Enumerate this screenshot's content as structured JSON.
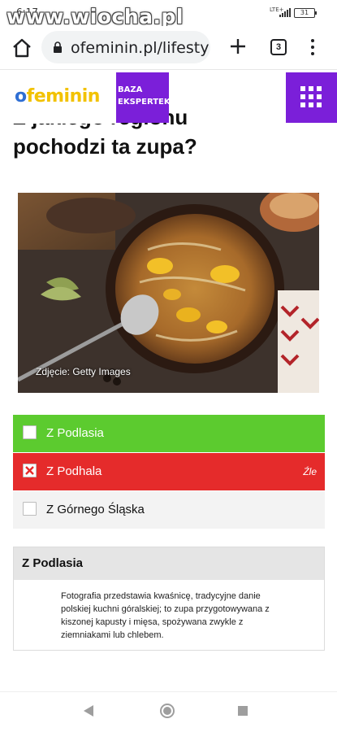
{
  "status_bar": {
    "time": "6:17",
    "watermark": "www.wiocha.pl",
    "network": "LTE+",
    "battery": "31"
  },
  "browser": {
    "url": "ofeminin.pl/lifesty",
    "tab_count": "3"
  },
  "site_header": {
    "logo_text": "ofeminin",
    "baza_line1": "BAZA",
    "baza_line2": "EKSPERTEK"
  },
  "question": {
    "title_line1": "Z jakiego regionu",
    "title_line2": "pochodzi ta zupa?"
  },
  "photo": {
    "credit": "Zdjęcie: Getty Images"
  },
  "answers": [
    {
      "label": "Z Podlasia",
      "state": "correct",
      "verdict": ""
    },
    {
      "label": "Z Podhala",
      "state": "wrong",
      "verdict": "Źle"
    },
    {
      "label": "Z Górnego Śląska",
      "state": "neutral",
      "verdict": ""
    }
  ],
  "result": {
    "title": "Z Podlasia",
    "text": "Fotografia przedstawia kwaśnicę, tradycyjne danie polskiej kuchni góralskiej; to zupa przygotowywana z kiszonej kapusty i mięsa, spożywana zwykle z ziemniakami lub chlebem."
  },
  "colors": {
    "correct": "#5ccb2f",
    "wrong": "#e52b2b",
    "brand_purple": "#7b1fd9"
  }
}
